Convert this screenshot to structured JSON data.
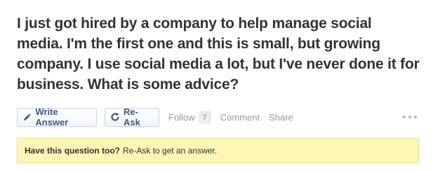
{
  "question": {
    "title": "I just got hired by a company to help manage social media. I'm the first one and this is small, but growing company. I use social media a lot, but I've never done it for business. What is some advice?"
  },
  "actions": {
    "write_answer_label": "Write Answer",
    "write_answer_icon": "pencil-icon",
    "reask_label": "Re-Ask",
    "reask_icon": "refresh-icon",
    "follow_label": "Follow",
    "follow_count": "7",
    "comment_label": "Comment",
    "share_label": "Share",
    "more_icon": "ellipsis-icon"
  },
  "notice": {
    "bold_text": "Have this question too?",
    "text": "Re-Ask to get an answer."
  },
  "colors": {
    "title": "#333333",
    "button_text": "#3b5b85",
    "button_border": "#c9d4e0",
    "link_text": "#999999",
    "notice_bg": "#fdf6b4",
    "notice_border": "#ebe08c"
  }
}
